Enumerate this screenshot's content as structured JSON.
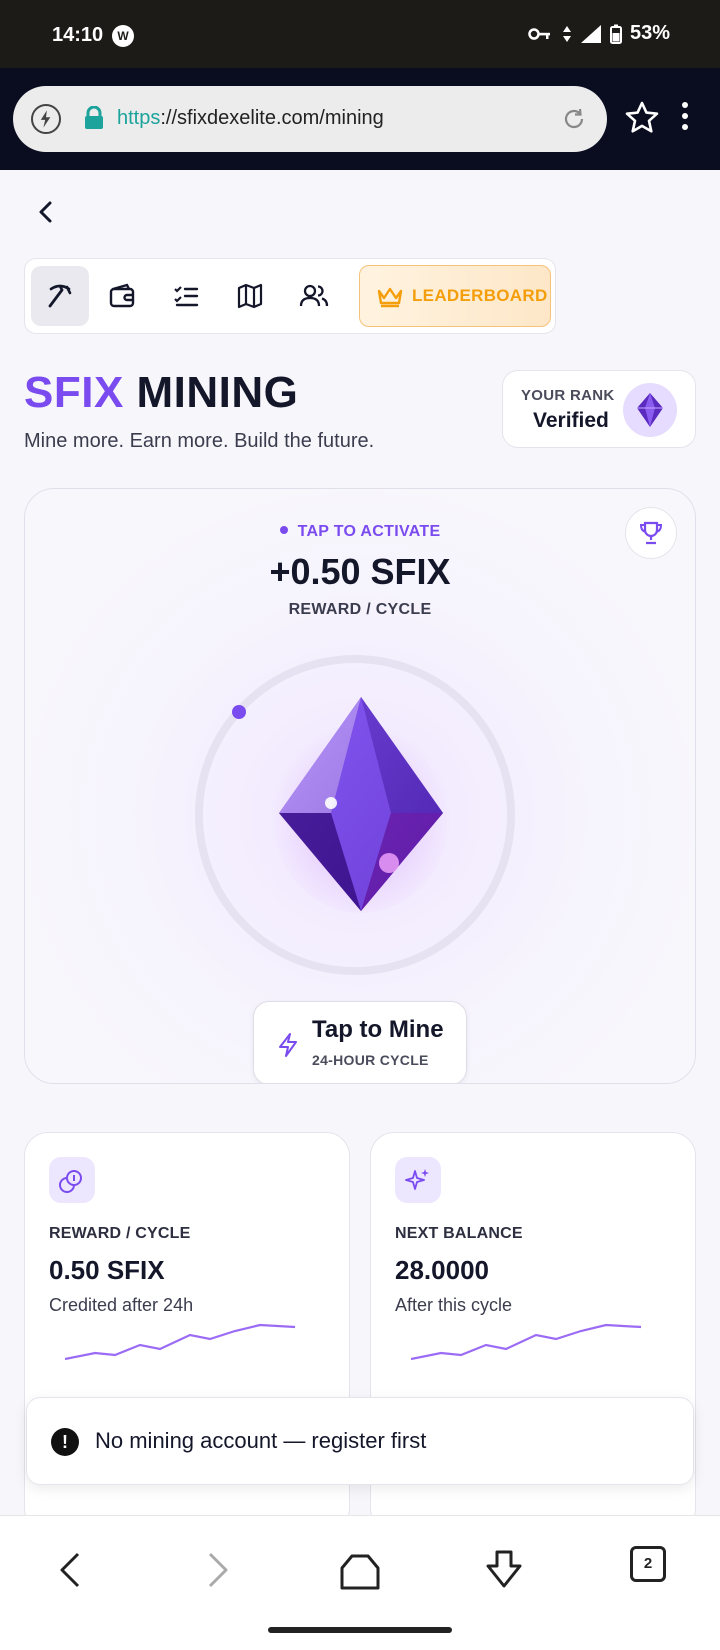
{
  "status_bar": {
    "time": "14:10",
    "battery": "53%"
  },
  "browser": {
    "url_scheme": "https",
    "url_rest": "://sfixdexelite.com/mining"
  },
  "nav": {
    "leaderboard_label": "LEADERBOARD"
  },
  "hero": {
    "brand": "SFIX",
    "title_rest": " MINING",
    "subtitle": "Mine more. Earn more. Build the future."
  },
  "rank": {
    "label": "YOUR RANK",
    "value": "Verified"
  },
  "mining": {
    "status": "TAP TO ACTIVATE",
    "reward": "+0.50 SFIX",
    "reward_caption": "REWARD / CYCLE",
    "button_title": "Tap to Mine",
    "button_sub": "24-HOUR CYCLE"
  },
  "stats": [
    {
      "label": "REWARD / CYCLE",
      "value": "0.50 SFIX",
      "note": "Credited after 24h"
    },
    {
      "label": "NEXT BALANCE",
      "value": "28.0000",
      "note": "After this cycle"
    }
  ],
  "toast": {
    "message": "No mining account — register first"
  },
  "bottom_nav": {
    "tabs_count": "2"
  },
  "colors": {
    "accent": "#7a4bef",
    "gold": "#f59e0b",
    "dark": "#14162a"
  }
}
